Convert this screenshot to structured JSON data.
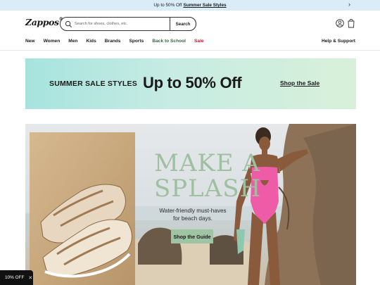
{
  "promo": {
    "text": "Up to 50% Off",
    "link": "Summer Sale Styles",
    "chevron_icon": "chevron-right-icon"
  },
  "header": {
    "logo": "Zappos",
    "logo_mark": "®",
    "search": {
      "placeholder": "Search for shoes, clothes, etc.",
      "button": "Search",
      "icon": "search-icon"
    },
    "account_icon": "account-icon",
    "cart_icon": "cart-icon"
  },
  "nav": {
    "items": [
      "New",
      "Women",
      "Men",
      "Kids",
      "Brands",
      "Sports",
      "Back to School",
      "Sale"
    ],
    "help": "Help & Support"
  },
  "sale_banner": {
    "label": "SUMMER SALE STYLES",
    "headline": "Up to 50% Off",
    "link": "Shop the Sale"
  },
  "hero": {
    "headline_line1": "MAKE A",
    "headline_line2": "SPLASH",
    "subtext": "Water-friendly must-haves for beach days.",
    "cta": "Shop the Guide"
  },
  "toast": {
    "text": "10% OFF",
    "close_icon": "close-icon"
  },
  "colors": {
    "promo_bg": "#d9ecf8",
    "banner_start": "#a7e3de",
    "banner_end": "#d8f0d9",
    "hero_green": "#9fbfa1",
    "cta_green": "#9fc4a4",
    "sale_red": "#c8102e",
    "school_green": "#2d6a3a"
  }
}
